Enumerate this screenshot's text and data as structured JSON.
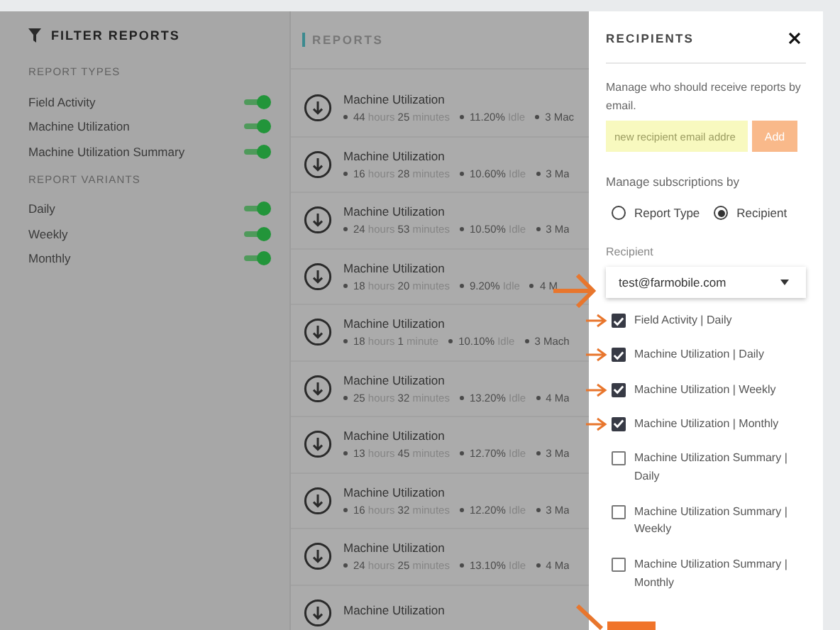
{
  "filter": {
    "title": "FILTER REPORTS",
    "sections": [
      {
        "title": "REPORT TYPES",
        "items": [
          {
            "label": "Field Activity",
            "on": true
          },
          {
            "label": "Machine Utilization",
            "on": true
          },
          {
            "label": "Machine Utilization Summary",
            "on": true
          }
        ]
      },
      {
        "title": "REPORT VARIANTS",
        "items": [
          {
            "label": "Daily",
            "on": true
          },
          {
            "label": "Weekly",
            "on": true
          },
          {
            "label": "Monthly",
            "on": true
          }
        ]
      }
    ]
  },
  "reports": {
    "title": "REPORTS",
    "rows": [
      {
        "title": "Machine Utilization",
        "duration": "**44** hours **25** minutes",
        "idle": "**11.20%** Idle",
        "machines": "3 Mac"
      },
      {
        "title": "Machine Utilization",
        "duration": "**16** hours **28** minutes",
        "idle": "**10.60%** Idle",
        "machines": "3 Ma"
      },
      {
        "title": "Machine Utilization",
        "duration": "**24** hours **53** minutes",
        "idle": "**10.50%** Idle",
        "machines": "3 Ma"
      },
      {
        "title": "Machine Utilization",
        "duration": "**18** hours **20** minutes",
        "idle": "**9.20%** Idle",
        "machines": "4 M"
      },
      {
        "title": "Machine Utilization",
        "duration": "**18** hours **1** minute",
        "idle": "**10.10%** Idle",
        "machines": "3 Mach"
      },
      {
        "title": "Machine Utilization",
        "duration": "**25** hours **32** minutes",
        "idle": "**13.20%** Idle",
        "machines": "4 Ma"
      },
      {
        "title": "Machine Utilization",
        "duration": "**13** hours **45** minutes",
        "idle": "**12.70%** Idle",
        "machines": "3 Ma"
      },
      {
        "title": "Machine Utilization",
        "duration": "**16** hours **32** minutes",
        "idle": "**12.20%** Idle",
        "machines": "3 Ma"
      },
      {
        "title": "Machine Utilization",
        "duration": "**24** hours **25** minutes",
        "idle": "**13.10%** Idle",
        "machines": "4 Ma"
      },
      {
        "title": "Machine Utilization"
      }
    ]
  },
  "drawer": {
    "title": "RECIPIENTS",
    "description": "Manage who should receive reports by email.",
    "email_field": {
      "placeholder": "new recipient email addre"
    },
    "add_button": "Add",
    "subscriptions_label": "Manage subscriptions by",
    "radios": [
      {
        "label": "Report Type",
        "selected": false
      },
      {
        "label": "Recipient",
        "selected": true
      }
    ],
    "recipient_label": "Recipient",
    "recipient_select": {
      "value": "test@farmobile.com"
    },
    "subscriptions": [
      {
        "label": "Field Activity | Daily",
        "checked": true
      },
      {
        "label": "Machine Utilization | Daily",
        "checked": true
      },
      {
        "label": "Machine Utilization | Weekly",
        "checked": true
      },
      {
        "label": "Machine Utilization | Monthly",
        "checked": true
      },
      {
        "label": "Machine Utilization Summary | Daily",
        "checked": false
      },
      {
        "label": "Machine Utilization Summary | Weekly",
        "checked": false
      },
      {
        "label": "Machine Utilization Summary | Monthly",
        "checked": false
      }
    ]
  }
}
